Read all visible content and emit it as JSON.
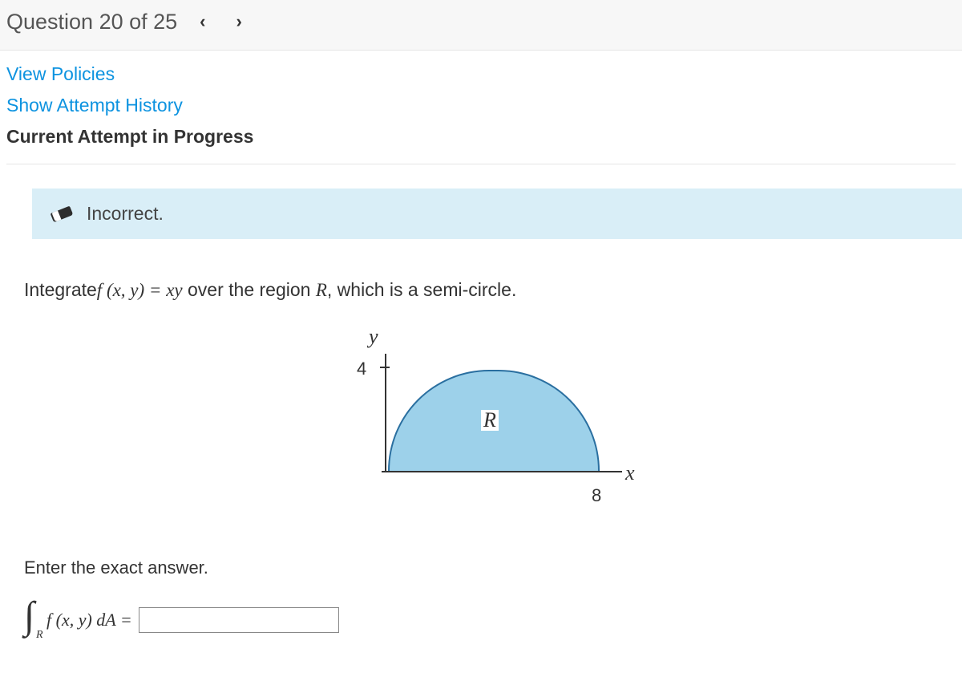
{
  "header": {
    "title": "Question 20 of 25"
  },
  "links": {
    "view_policies": "View Policies",
    "show_attempt": "Show Attempt History",
    "current_attempt": "Current Attempt in Progress"
  },
  "status": {
    "text": "Incorrect."
  },
  "question": {
    "prefix": "Integrate",
    "func_part1": "f ",
    "func_part2": "(x, y) = xy",
    "middle": " over the region ",
    "region": "R",
    "suffix": ", which is a semi-circle."
  },
  "figure": {
    "y_label": "y",
    "y_tick_value": "4",
    "region_label": "R",
    "x_label": "x",
    "x_tick_value": "8"
  },
  "answer": {
    "prompt": "Enter the exact answer.",
    "integrand": "f (x, y) dA =",
    "sub": "R",
    "input_value": ""
  }
}
